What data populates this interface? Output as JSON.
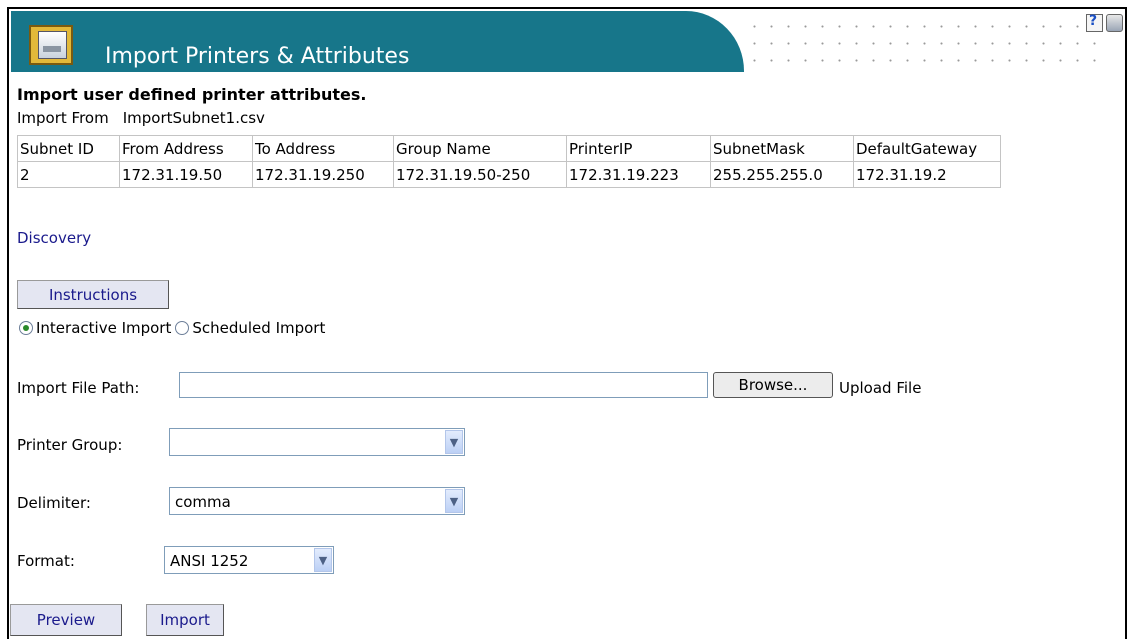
{
  "header": {
    "title": "Import Printers & Attributes",
    "icon": "printer-folder-icon",
    "tools": [
      "help-icon",
      "printer-icon"
    ],
    "banner_color": "#17768a"
  },
  "subtitle": "Import user defined printer attributes.",
  "import_from": {
    "label": "Import From",
    "file": "ImportSubnet1.csv"
  },
  "table": {
    "headers": [
      "Subnet ID",
      "From Address",
      "To Address",
      "Group Name",
      "PrinterIP",
      "SubnetMask",
      "DefaultGateway"
    ],
    "rows": [
      [
        "2",
        "172.31.19.50",
        "172.31.19.250",
        "172.31.19.50-250",
        "172.31.19.223",
        "255.255.255.0",
        "172.31.19.2"
      ]
    ]
  },
  "discovery_link": "Discovery",
  "instructions_button": "Instructions",
  "import_mode": {
    "options": [
      "Interactive Import",
      "Scheduled Import"
    ],
    "selected": "Interactive Import"
  },
  "file_path": {
    "label": "Import File Path:",
    "value": "",
    "browse": "Browse...",
    "upload": "Upload File"
  },
  "printer_group": {
    "label": "Printer Group:",
    "value": ""
  },
  "delimiter": {
    "label": "Delimiter:",
    "value": "comma"
  },
  "format": {
    "label": "Format:",
    "value": "ANSI 1252"
  },
  "actions": {
    "preview": "Preview",
    "import": "Import"
  }
}
